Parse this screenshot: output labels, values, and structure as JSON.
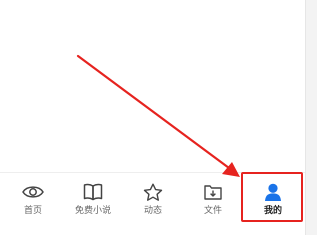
{
  "tabbar": {
    "tabs": [
      {
        "label": "首页",
        "icon": "eye-icon"
      },
      {
        "label": "免费小说",
        "icon": "book-icon"
      },
      {
        "label": "动态",
        "icon": "star-icon"
      },
      {
        "label": "文件",
        "icon": "download-folder-icon"
      },
      {
        "label": "我的",
        "icon": "user-icon",
        "active": true
      }
    ]
  },
  "annotation": {
    "color": "#e6231f",
    "target": "我的"
  },
  "colors": {
    "accent": "#1a73e8",
    "inactive_icon": "#444444"
  }
}
